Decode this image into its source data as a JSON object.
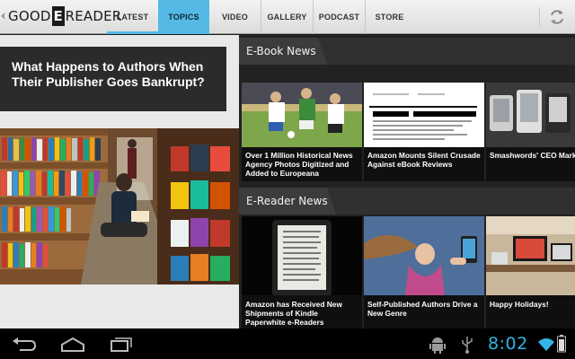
{
  "header": {
    "logo": {
      "left_word": "GOOD",
      "middle_letter": "E",
      "right_word": "READER"
    },
    "tabs": [
      {
        "label": "LATEST"
      },
      {
        "label": "TOPICS"
      },
      {
        "label": "VIDEO"
      },
      {
        "label": "GALLERY"
      },
      {
        "label": "PODCAST"
      },
      {
        "label": "STORE"
      }
    ],
    "active_tab": "TOPICS",
    "refresh_icon": "refresh-icon"
  },
  "feature": {
    "title": "What Happens to Authors When Their Publisher Goes Bankrupt?"
  },
  "sections": [
    {
      "title": "E-Book News",
      "cards": [
        {
          "caption": "Over 1 Million Historical News Agency Photos Digitized and Added to Europeana"
        },
        {
          "caption": "Amazon Mounts Silent Crusade Against eBook Reviews"
        },
        {
          "caption": "Smashwords' CEO Mark the Tsunami of Self-Publ"
        }
      ]
    },
    {
      "title": "E-Reader News",
      "cards": [
        {
          "caption": "Amazon has Received New Shipments of Kindle Paperwhite e-Readers"
        },
        {
          "caption": "Self-Published Authors Drive a New Genre"
        },
        {
          "caption": "Happy Holidays!"
        }
      ]
    }
  ],
  "system_bar": {
    "clock": "8:02",
    "icons": [
      "back-icon",
      "home-icon",
      "recent-apps-icon",
      "android-icon",
      "usb-icon",
      "wifi-icon",
      "battery-icon"
    ],
    "accent": "#34b5e5"
  },
  "colors": {
    "active_tab": "#55b9e5",
    "dark_panel": "#2b2b2b"
  }
}
